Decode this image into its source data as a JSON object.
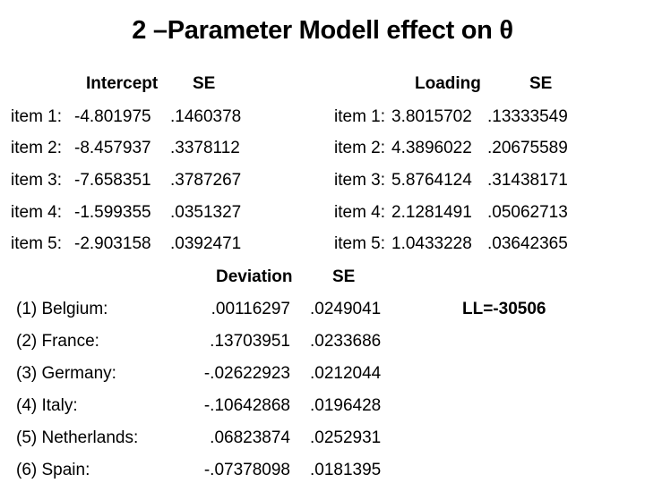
{
  "title": "2 –Parameter Modell effect on θ",
  "intercept_table": {
    "headers": {
      "estimate": "Intercept",
      "se": "SE"
    },
    "rows": [
      {
        "label": "item 1:",
        "estimate": "-4.801975",
        "se": ".1460378"
      },
      {
        "label": "item 2:",
        "estimate": "-8.457937",
        "se": ".3378112"
      },
      {
        "label": "item 3:",
        "estimate": "-7.658351",
        "se": ".3787267"
      },
      {
        "label": "item 4:",
        "estimate": "-1.599355",
        "se": ".0351327"
      },
      {
        "label": "item 5:",
        "estimate": "-2.903158",
        "se": ".0392471"
      }
    ]
  },
  "loading_table": {
    "headers": {
      "estimate": "Loading",
      "se": "SE"
    },
    "rows": [
      {
        "label": "item 1:",
        "estimate": "3.8015702",
        "se": ".13333549"
      },
      {
        "label": "item 2:",
        "estimate": "4.3896022",
        "se": ".20675589"
      },
      {
        "label": "item 3:",
        "estimate": "5.8764124",
        "se": ".31438171"
      },
      {
        "label": "item 4:",
        "estimate": "2.1281491",
        "se": ".05062713"
      },
      {
        "label": "item 5:",
        "estimate": "1.0433228",
        "se": ".03642365"
      }
    ]
  },
  "deviation_table": {
    "headers": {
      "estimate": "Deviation",
      "se": "SE"
    },
    "rows": [
      {
        "label": "(1) Belgium:",
        "estimate": ".00116297",
        "se": ".0249041"
      },
      {
        "label": "(2) France:",
        "estimate": ".13703951",
        "se": ".0233686"
      },
      {
        "label": "(3) Germany:",
        "estimate": "-.02622923",
        "se": ".0212044"
      },
      {
        "label": "(4) Italy:",
        "estimate": "-.10642868",
        "se": ".0196428"
      },
      {
        "label": "(5) Netherlands:",
        "estimate": ".06823874",
        "se": ".0252931"
      },
      {
        "label": "(6) Spain:",
        "estimate": "-.07378098",
        "se": ".0181395"
      }
    ]
  },
  "log_likelihood": "LL=-30506"
}
